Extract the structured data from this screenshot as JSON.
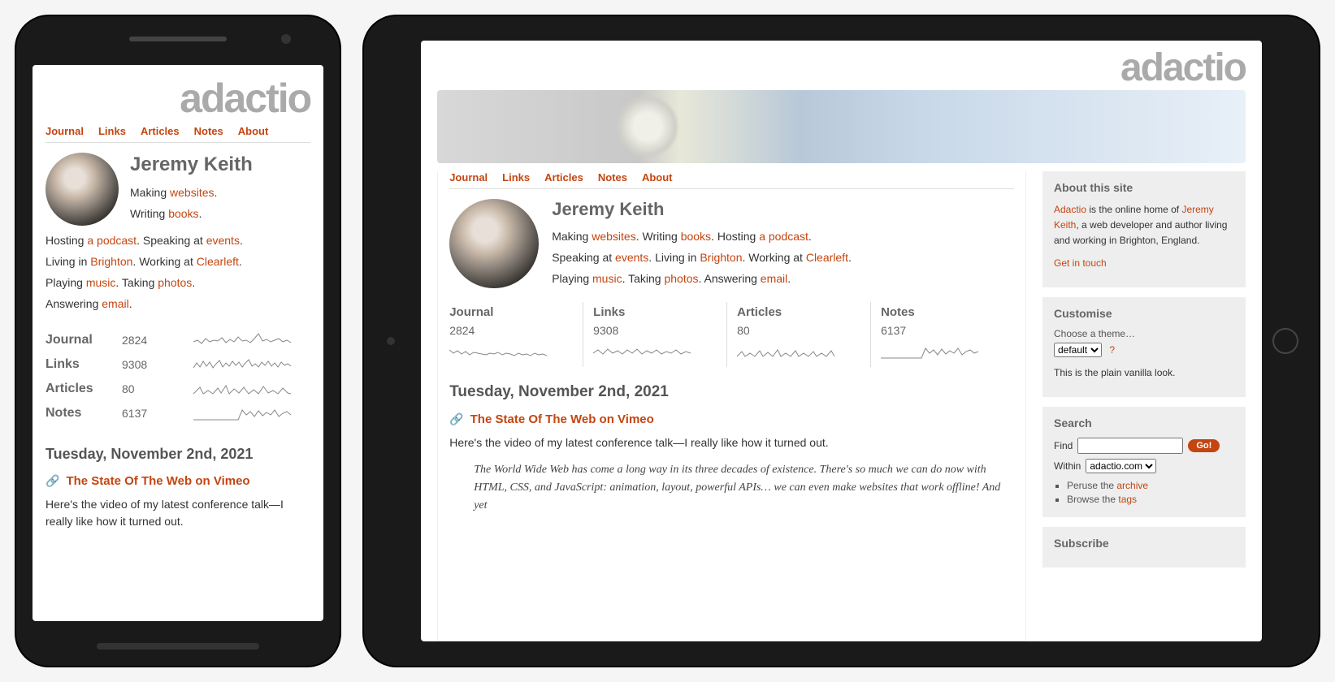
{
  "logo": "adactio",
  "nav": [
    "Journal",
    "Links",
    "Articles",
    "Notes",
    "About"
  ],
  "author": {
    "name": "Jeremy Keith",
    "bio": {
      "making": "Making ",
      "making_link": "websites",
      "writing": "Writing ",
      "writing_link": "books",
      "hosting": "Hosting ",
      "hosting_link": "a podcast",
      "speaking": "Speaking at ",
      "speaking_link": "events",
      "living": "Living in ",
      "living_link": "Brighton",
      "working": "Working at ",
      "working_link": "Clearleft",
      "playing": "Playing ",
      "playing_link": "music",
      "taking": "Taking ",
      "taking_link": "photos",
      "answering": "Answering ",
      "answering_link": "email"
    }
  },
  "stats": {
    "journal": {
      "label": "Journal",
      "count": "2824"
    },
    "links": {
      "label": "Links",
      "count": "9308"
    },
    "articles": {
      "label": "Articles",
      "count": "80"
    },
    "notes": {
      "label": "Notes",
      "count": "6137"
    }
  },
  "post": {
    "date": "Tuesday, November 2nd, 2021",
    "title": "The State Of The Web on Vimeo",
    "excerpt": "Here's the video of my latest conference talk—I really like how it turned out.",
    "quote": "The World Wide Web has come a long way in its three decades of existence. There's so much we can do now with HTML, CSS, and JavaScript: animation, layout, powerful APIs… we can even make websites that work offline! And yet"
  },
  "sidebar": {
    "about": {
      "heading": "About this site",
      "link1": "Adactio",
      "text1": " is the online home of ",
      "link2": "Jeremy Keith",
      "text2": ", a web developer and author living and working in Brighton, England.",
      "contact": "Get in touch"
    },
    "customise": {
      "heading": "Customise",
      "label": "Choose a theme…",
      "selected": "default",
      "help": "?",
      "desc": "This is the plain vanilla look."
    },
    "search": {
      "heading": "Search",
      "find_label": "Find",
      "go": "Go!",
      "within_label": "Within",
      "within_selected": "adactio.com",
      "peruse": "Peruse the ",
      "peruse_link": "archive",
      "browse": "Browse the ",
      "browse_link": "tags"
    },
    "subscribe": {
      "heading": "Subscribe"
    }
  }
}
